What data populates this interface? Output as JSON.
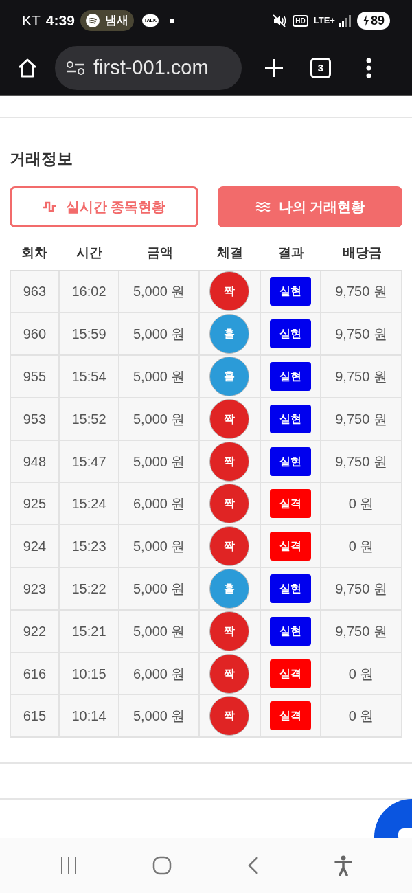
{
  "status_bar": {
    "carrier": "KT",
    "time": "4:39",
    "media_pill": "냄새",
    "chat_badge": "TALK",
    "hd": "HD",
    "network": "LTE+",
    "battery": "89"
  },
  "browser": {
    "url": "first-001.com",
    "tab_count": "3"
  },
  "section_title": "거래정보",
  "tabs": [
    {
      "label": "실시간 종목현황",
      "selected": false
    },
    {
      "label": "나의 거래현황",
      "selected": true
    }
  ],
  "table": {
    "columns": [
      "회차",
      "시간",
      "금액",
      "체결",
      "결과",
      "배당금"
    ],
    "rows": [
      {
        "round": "963",
        "time": "16:02",
        "amount": "5,000 원",
        "fill": {
          "label": "짝",
          "color": "#e02424"
        },
        "result": {
          "label": "실현",
          "color": "#0000ee"
        },
        "payout": "9,750 원"
      },
      {
        "round": "960",
        "time": "15:59",
        "amount": "5,000 원",
        "fill": {
          "label": "홀",
          "color": "#2b9bd8"
        },
        "result": {
          "label": "실현",
          "color": "#0000ee"
        },
        "payout": "9,750 원"
      },
      {
        "round": "955",
        "time": "15:54",
        "amount": "5,000 원",
        "fill": {
          "label": "홀",
          "color": "#2b9bd8"
        },
        "result": {
          "label": "실현",
          "color": "#0000ee"
        },
        "payout": "9,750 원"
      },
      {
        "round": "953",
        "time": "15:52",
        "amount": "5,000 원",
        "fill": {
          "label": "짝",
          "color": "#e02424"
        },
        "result": {
          "label": "실현",
          "color": "#0000ee"
        },
        "payout": "9,750 원"
      },
      {
        "round": "948",
        "time": "15:47",
        "amount": "5,000 원",
        "fill": {
          "label": "짝",
          "color": "#e02424"
        },
        "result": {
          "label": "실현",
          "color": "#0000ee"
        },
        "payout": "9,750 원"
      },
      {
        "round": "925",
        "time": "15:24",
        "amount": "6,000 원",
        "fill": {
          "label": "짝",
          "color": "#e02424"
        },
        "result": {
          "label": "실격",
          "color": "#ff0000"
        },
        "payout": "0 원"
      },
      {
        "round": "924",
        "time": "15:23",
        "amount": "5,000 원",
        "fill": {
          "label": "짝",
          "color": "#e02424"
        },
        "result": {
          "label": "실격",
          "color": "#ff0000"
        },
        "payout": "0 원"
      },
      {
        "round": "923",
        "time": "15:22",
        "amount": "5,000 원",
        "fill": {
          "label": "홀",
          "color": "#2b9bd8"
        },
        "result": {
          "label": "실현",
          "color": "#0000ee"
        },
        "payout": "9,750 원"
      },
      {
        "round": "922",
        "time": "15:21",
        "amount": "5,000 원",
        "fill": {
          "label": "짝",
          "color": "#e02424"
        },
        "result": {
          "label": "실현",
          "color": "#0000ee"
        },
        "payout": "9,750 원"
      },
      {
        "round": "616",
        "time": "10:15",
        "amount": "6,000 원",
        "fill": {
          "label": "짝",
          "color": "#e02424"
        },
        "result": {
          "label": "실격",
          "color": "#ff0000"
        },
        "payout": "0 원"
      },
      {
        "round": "615",
        "time": "10:14",
        "amount": "5,000 원",
        "fill": {
          "label": "짝",
          "color": "#e02424"
        },
        "result": {
          "label": "실격",
          "color": "#ff0000"
        },
        "payout": "0 원"
      }
    ]
  }
}
